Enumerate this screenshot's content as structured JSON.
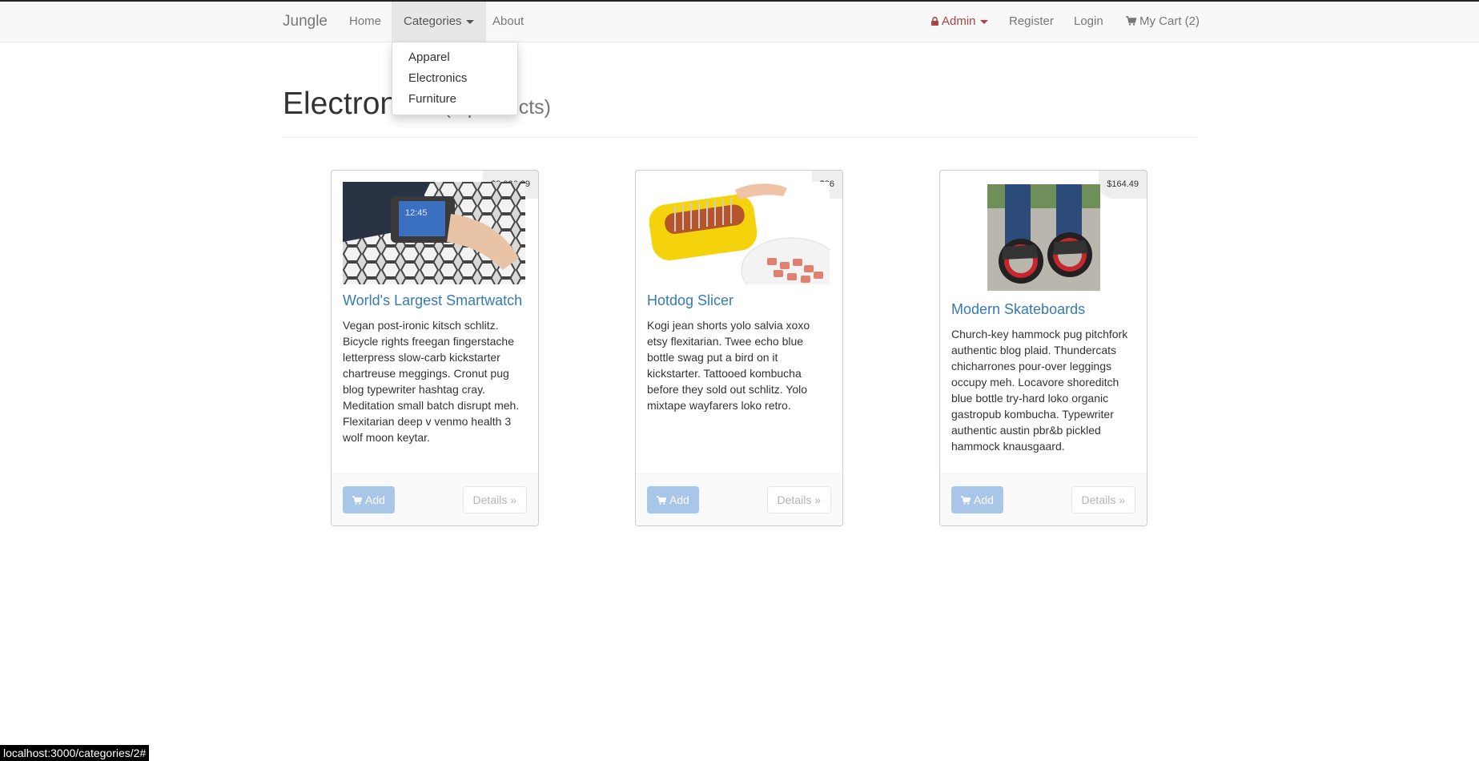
{
  "navbar": {
    "brand": "Jungle",
    "home": "Home",
    "categories": "Categories",
    "about": "About",
    "admin": "Admin",
    "register": "Register",
    "login": "Login",
    "cart": "My Cart (2)",
    "lock_icon": "lock-icon",
    "cart_icon": "shopping-cart-icon"
  },
  "dropdown": {
    "items": [
      "Apparel",
      "Electronics",
      "Furniture"
    ]
  },
  "page": {
    "title": "Electronics",
    "subtitle": "(3 products)"
  },
  "products": [
    {
      "name": "World's Largest Smartwatch",
      "price": "$2,026.29",
      "description": "Vegan post-ironic kitsch schlitz. Bicycle rights freegan fingerstache letterpress slow-carb kickstarter chartreuse meggings. Cronut pug blog typewriter hashtag cray. Meditation small batch disrupt meh. Flexitarian deep v venmo health 3 wolf moon keytar.",
      "add_label": "Add",
      "details_label": "Details »"
    },
    {
      "name": "Hotdog Slicer",
      "price": "$26",
      "description": "Kogi jean shorts yolo salvia xoxo etsy flexitarian. Twee echo blue bottle swag put a bird on it kickstarter. Tattooed kombucha before they sold out schlitz. Yolo mixtape wayfarers loko retro.",
      "add_label": "Add",
      "details_label": "Details »"
    },
    {
      "name": "Modern Skateboards",
      "price": "$164.49",
      "description": "Church-key hammock pug pitchfork authentic blog plaid. Thundercats chicharrones pour-over leggings occupy meh. Locavore shoreditch blue bottle try-hard loko organic gastropub kombucha. Typewriter authentic austin pbr&b pickled hammock knausgaard.",
      "add_label": "Add",
      "details_label": "Details »"
    }
  ],
  "status_bar": "localhost:3000/categories/2#",
  "colors": {
    "link": "#337ab7",
    "admin": "#a94442",
    "navbar_bg": "#f8f8f8",
    "add_button": "#a7c6e8"
  }
}
